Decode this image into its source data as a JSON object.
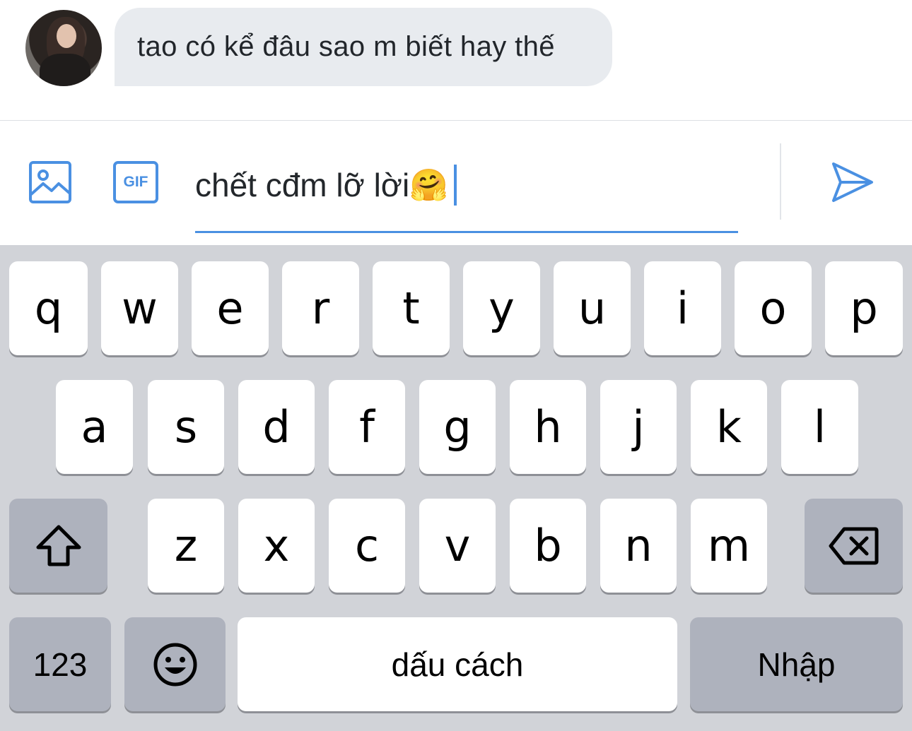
{
  "chat": {
    "message": "tao có kể đâu sao m biết hay thế"
  },
  "composer": {
    "gif_label": "GIF",
    "input_text": "chết cđm lỡ lời",
    "input_emoji": "🤗"
  },
  "keyboard": {
    "row1": [
      "q",
      "w",
      "e",
      "r",
      "t",
      "y",
      "u",
      "i",
      "o",
      "p"
    ],
    "row2": [
      "a",
      "s",
      "d",
      "f",
      "g",
      "h",
      "j",
      "k",
      "l"
    ],
    "row3": [
      "z",
      "x",
      "c",
      "v",
      "b",
      "n",
      "m"
    ],
    "numbers_label": "123",
    "space_label": "dấu cách",
    "return_label": "Nhập"
  },
  "colors": {
    "accent": "#4a90e2",
    "bubble": "#e8ebef",
    "keyboard_bg": "#d1d3d8",
    "key_dark": "#aeb2bd"
  },
  "icons": [
    "avatar",
    "image-icon",
    "gif-icon",
    "send-icon",
    "shift-icon",
    "backspace-icon",
    "emoji-icon"
  ]
}
